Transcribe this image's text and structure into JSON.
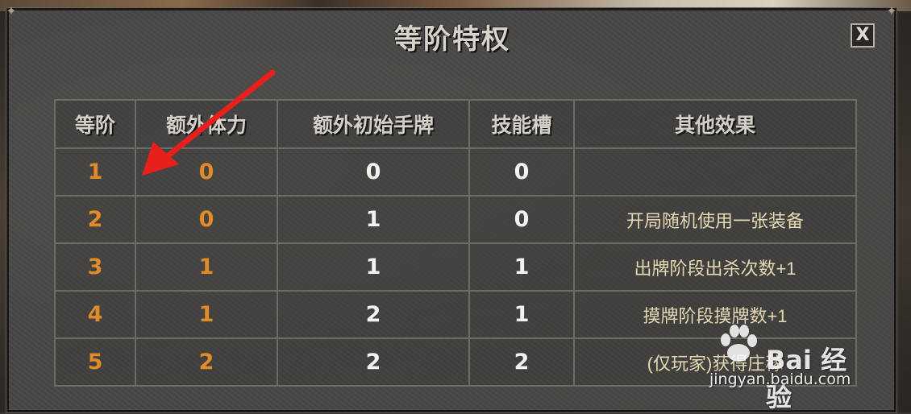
{
  "dialog": {
    "title": "等阶特权",
    "close_label": "X"
  },
  "table": {
    "headers": [
      "等阶",
      "额外体力",
      "额外初始手牌",
      "技能槽",
      "其他效果"
    ],
    "rows": [
      [
        "1",
        "0",
        "0",
        "0",
        ""
      ],
      [
        "2",
        "0",
        "1",
        "0",
        "开局随机使用一张装备"
      ],
      [
        "3",
        "1",
        "1",
        "1",
        "出牌阶段出杀次数+1"
      ],
      [
        "4",
        "1",
        "2",
        "1",
        "摸牌阶段摸牌数+1"
      ],
      [
        "5",
        "2",
        "2",
        "2",
        "(仅玩家)获得庄稼"
      ]
    ]
  },
  "watermark": {
    "brand": "Bai 经验",
    "url": "jingyan.baidu.com"
  },
  "colors": {
    "level_text": "#e08a2a",
    "value_text": "#f2f2f2",
    "effect_text": "#e4d8b4",
    "arrow": "#e8201c"
  }
}
